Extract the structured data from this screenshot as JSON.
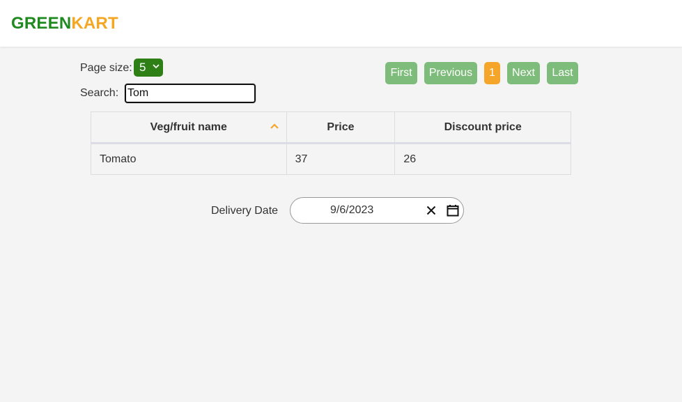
{
  "header": {
    "brand_part1": "GREEN",
    "brand_part2": "KART",
    "brand_colors": {
      "green": "#1f8a1f",
      "orange": "#f5a623"
    }
  },
  "controls": {
    "page_size_label": "Page size:",
    "page_size_value": "5",
    "search_label": "Search:",
    "search_value": "Tom"
  },
  "pagination": {
    "first": "First",
    "previous": "Previous",
    "current": "1",
    "next": "Next",
    "last": "Last",
    "button_color": "#7dbc7a",
    "active_color": "#f4a52a"
  },
  "table": {
    "headers": [
      "Veg/fruit name",
      "Price",
      "Discount price"
    ],
    "sorted_column": "Veg/fruit name",
    "sort_direction": "ascending",
    "rows": [
      [
        "Tomato",
        "37",
        "26"
      ]
    ]
  },
  "delivery": {
    "label": "Delivery Date",
    "date_value": "9/6/2023",
    "clear_icon": "close-icon",
    "calendar_icon": "calendar-icon"
  }
}
